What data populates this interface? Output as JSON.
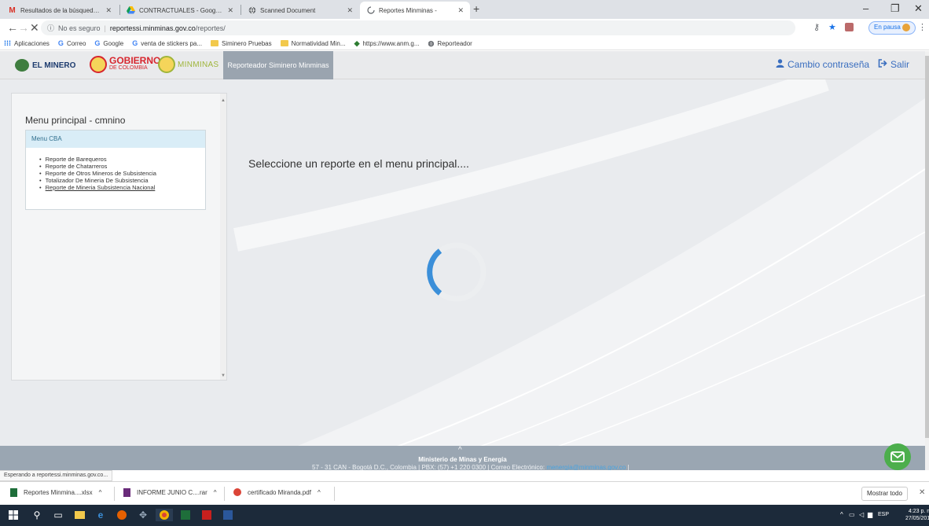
{
  "browser": {
    "tabs": [
      {
        "label": "Resultados de la búsqueda - cmnino",
        "icon": "gmail-icon"
      },
      {
        "label": "CONTRACTUALES - Google Drive",
        "icon": "drive-icon"
      },
      {
        "label": "Scanned Document",
        "icon": "globe-icon"
      },
      {
        "label": "Reportes Minminas -",
        "icon": "loading-icon"
      }
    ],
    "new_tab": "+",
    "window_controls": {
      "minimize": "–",
      "maximize": "❐",
      "close": "✕"
    },
    "nav": {
      "back": "←",
      "forward": "→",
      "stop": "✕"
    },
    "address": {
      "security": "No es seguro",
      "host": "reportessi.minminas.gov.co",
      "path": "/reportes/"
    },
    "pause_label": "En pausa",
    "bookmarks": [
      {
        "label": "Aplicaciones",
        "icon": "apps-icon"
      },
      {
        "label": "Correo",
        "icon": "google-icon"
      },
      {
        "label": "Google",
        "icon": "google-icon"
      },
      {
        "label": "venta de stickers pa...",
        "icon": "google-icon"
      },
      {
        "label": "Siminero Pruebas",
        "icon": "folder-icon"
      },
      {
        "label": "Normatividad Min...",
        "icon": "folder-icon"
      },
      {
        "label": "https://www.anm.g...",
        "icon": "diamond-icon"
      },
      {
        "label": "Reporteador",
        "icon": "globe-icon"
      }
    ]
  },
  "app": {
    "logos": {
      "minero": "EL MINERO",
      "gobierno": "GOBIERNO",
      "gobierno_sub": "DE COLOMBIA",
      "minminas": "MINMINAS"
    },
    "active_nav": "Reporteador Siminero Minminas",
    "change_password": "Cambio contraseña",
    "logout": "Salir",
    "menu": {
      "title": "Menu principal - cmnino",
      "section": "Menu CBA",
      "items": [
        "Reporte de Barequeros",
        "Reporte de Chatarreros",
        "Reporte de Otros Mineros de Subsistencia",
        "Totalizador De Mineria De Subsistencia",
        "Reporte de Mineria Subsistencia Nacional"
      ]
    },
    "main_message": "Seleccione un reporte en el menu principal....",
    "footer": {
      "chevron": "^",
      "title": "Ministerio de Minas y Energía",
      "address": "57 - 31 CAN - Bogotá D.C., Colombia | PBX: (57) +1 220 0300 | Correo Electrónico:",
      "email": "menergia@minminas.gov.co",
      "end": "|"
    }
  },
  "status_text": "Esperando a reportessi.minminas.gov.co...",
  "downloads": {
    "items": [
      {
        "label": "Reportes Minmina....xlsx",
        "icon": "excel-icon"
      },
      {
        "label": "INFORME JUNIO C....rar",
        "icon": "rar-icon"
      },
      {
        "label": "certificado Miranda.pdf",
        "icon": "chrome-pdf-icon"
      }
    ],
    "show_all": "Mostrar todo",
    "close": "✕"
  },
  "taskbar": {
    "lang": "ESP",
    "time": "4:23 p. m.",
    "date": "27/05/2019"
  },
  "colors": {
    "accent_blue": "#3a6ebf",
    "spinner": "#3b8fd9",
    "footer": "#9aa6b2",
    "fab_green": "#4cae4c",
    "menu_head": "#d9edf7"
  }
}
